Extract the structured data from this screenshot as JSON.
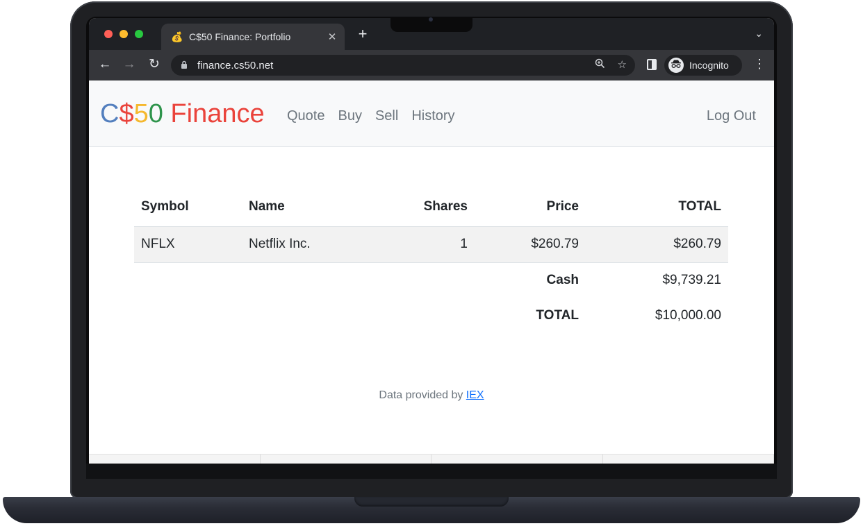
{
  "browser": {
    "tab_title": "C$50 Finance: Portfolio",
    "tab_favicon": "💰",
    "tab_close": "✕",
    "new_tab": "+",
    "tab_menu": "⌄",
    "url": "finance.cs50.net",
    "profile_label": "Incognito",
    "icons": [
      "back-arrow-icon",
      "forward-arrow-icon",
      "reload-icon",
      "lock-icon",
      "zoom-icon",
      "star-icon",
      "side-panel-icon",
      "incognito-icon",
      "kebab-menu-icon"
    ]
  },
  "navbar": {
    "brand": {
      "c": "C",
      "dollar": "$",
      "five": "5",
      "zero": "0",
      "finance": " Finance"
    },
    "links": [
      "Quote",
      "Buy",
      "Sell",
      "History"
    ],
    "logout": "Log Out"
  },
  "portfolio": {
    "headers": [
      "Symbol",
      "Name",
      "Shares",
      "Price",
      "TOTAL"
    ],
    "rows": [
      {
        "symbol": "NFLX",
        "name": "Netflix Inc.",
        "shares": "1",
        "price": "$260.79",
        "total": "$260.79"
      }
    ],
    "cash_label": "Cash",
    "cash_value": "$9,739.21",
    "total_label": "TOTAL",
    "total_value": "$10,000.00"
  },
  "footer": {
    "text": "Data provided by ",
    "link": "IEX"
  },
  "colors": {
    "brand_blue": "#537fbe",
    "brand_red": "#ea433b",
    "brand_yellow": "#f5b82e",
    "brand_green": "#2e944b",
    "link": "#0d6efd"
  }
}
